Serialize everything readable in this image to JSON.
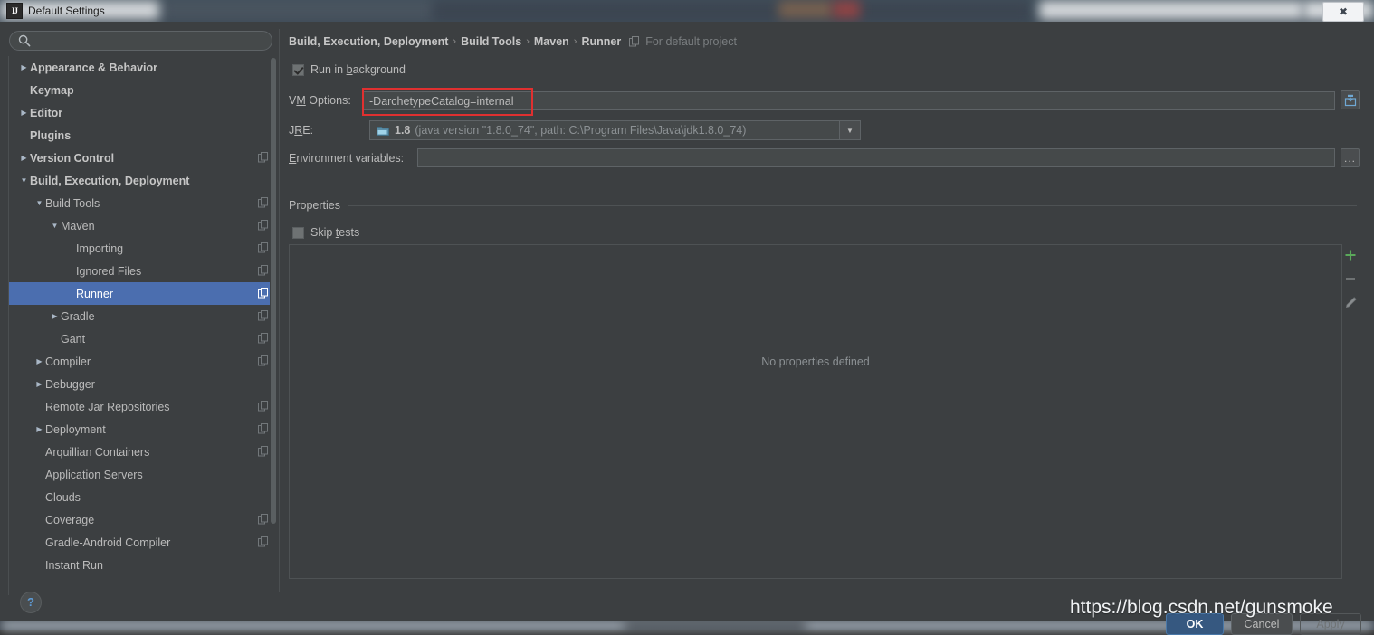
{
  "window": {
    "title": "Default Settings",
    "app_icon": "intellij-idea-icon",
    "close_label": "✖"
  },
  "search": {
    "value": "",
    "placeholder": "",
    "icon": "search-icon"
  },
  "sidebar": {
    "items": [
      {
        "label": "Appearance & Behavior",
        "level": 0,
        "arrow": "▶",
        "bold": true,
        "selected": false,
        "copy": false
      },
      {
        "label": "Keymap",
        "level": 0,
        "arrow": "",
        "bold": true,
        "selected": false,
        "copy": false
      },
      {
        "label": "Editor",
        "level": 0,
        "arrow": "▶",
        "bold": true,
        "selected": false,
        "copy": false
      },
      {
        "label": "Plugins",
        "level": 0,
        "arrow": "",
        "bold": true,
        "selected": false,
        "copy": false
      },
      {
        "label": "Version Control",
        "level": 0,
        "arrow": "▶",
        "bold": true,
        "selected": false,
        "copy": true
      },
      {
        "label": "Build, Execution, Deployment",
        "level": 0,
        "arrow": "▼",
        "bold": true,
        "selected": false,
        "copy": false
      },
      {
        "label": "Build Tools",
        "level": 1,
        "arrow": "▼",
        "bold": false,
        "selected": false,
        "copy": true
      },
      {
        "label": "Maven",
        "level": 2,
        "arrow": "▼",
        "bold": false,
        "selected": false,
        "copy": true
      },
      {
        "label": "Importing",
        "level": 3,
        "arrow": "",
        "bold": false,
        "selected": false,
        "copy": true
      },
      {
        "label": "Ignored Files",
        "level": 3,
        "arrow": "",
        "bold": false,
        "selected": false,
        "copy": true
      },
      {
        "label": "Runner",
        "level": 3,
        "arrow": "",
        "bold": false,
        "selected": true,
        "copy": true
      },
      {
        "label": "Gradle",
        "level": 2,
        "arrow": "▶",
        "bold": false,
        "selected": false,
        "copy": true
      },
      {
        "label": "Gant",
        "level": 2,
        "arrow": "",
        "bold": false,
        "selected": false,
        "copy": true
      },
      {
        "label": "Compiler",
        "level": 1,
        "arrow": "▶",
        "bold": false,
        "selected": false,
        "copy": true
      },
      {
        "label": "Debugger",
        "level": 1,
        "arrow": "▶",
        "bold": false,
        "selected": false,
        "copy": false
      },
      {
        "label": "Remote Jar Repositories",
        "level": 1,
        "arrow": "",
        "bold": false,
        "selected": false,
        "copy": true
      },
      {
        "label": "Deployment",
        "level": 1,
        "arrow": "▶",
        "bold": false,
        "selected": false,
        "copy": true
      },
      {
        "label": "Arquillian Containers",
        "level": 1,
        "arrow": "",
        "bold": false,
        "selected": false,
        "copy": true
      },
      {
        "label": "Application Servers",
        "level": 1,
        "arrow": "",
        "bold": false,
        "selected": false,
        "copy": false
      },
      {
        "label": "Clouds",
        "level": 1,
        "arrow": "",
        "bold": false,
        "selected": false,
        "copy": false
      },
      {
        "label": "Coverage",
        "level": 1,
        "arrow": "",
        "bold": false,
        "selected": false,
        "copy": true
      },
      {
        "label": "Gradle-Android Compiler",
        "level": 1,
        "arrow": "",
        "bold": false,
        "selected": false,
        "copy": true
      },
      {
        "label": "Instant Run",
        "level": 1,
        "arrow": "",
        "bold": false,
        "selected": false,
        "copy": false
      }
    ]
  },
  "breadcrumb": {
    "crumbs": [
      "Build, Execution, Deployment",
      "Build Tools",
      "Maven",
      "Runner"
    ],
    "separator": "›",
    "project_scope": "For default project",
    "project_icon": "copy-icon"
  },
  "main": {
    "run_in_background": {
      "label_pre": "Run in ",
      "label_mnemonic": "b",
      "label_post": "ackground",
      "checked": true
    },
    "vm_options": {
      "label_pre": "V",
      "label_mnemonic": "M",
      "label_post": " Options:",
      "value": "-DarchetypeCatalog=internal",
      "expand_icon": "expand-insert-icon"
    },
    "jre": {
      "label_pre": "J",
      "label_mnemonic": "R",
      "label_post": "E:",
      "version": "1.8",
      "detail": "(java version \"1.8.0_74\", path: C:\\Program Files\\Java\\jdk1.8.0_74)",
      "icon": "folder-icon",
      "dropdown_icon": "chevron-down-icon"
    },
    "environment_variables": {
      "label_pre": "",
      "label_mnemonic": "E",
      "label_post": "nvironment variables:",
      "value": "",
      "browse_label": "..."
    },
    "properties_section": {
      "title": "Properties"
    },
    "skip_tests": {
      "label_pre": "Skip ",
      "label_mnemonic": "t",
      "label_post": "ests",
      "checked": false
    },
    "properties_table": {
      "empty_message": "No properties defined",
      "toolbar": [
        {
          "name": "add-property-button",
          "icon": "plus-icon",
          "color": "#5aa85a"
        },
        {
          "name": "remove-property-button",
          "icon": "minus-icon",
          "color": "#6e7273"
        },
        {
          "name": "edit-property-button",
          "icon": "pencil-icon",
          "color": "#8a8e90"
        }
      ]
    }
  },
  "footer": {
    "help_label": "?",
    "ok_label": "OK",
    "cancel_label": "Cancel",
    "apply_label": "Apply"
  },
  "watermark": {
    "text": "https://blog.csdn.net/gunsmoke"
  },
  "colors": {
    "accent_selection": "#4b6eaf",
    "ok_button": "#365880",
    "highlight_box": "#e03030",
    "panel_bg": "#3c3f41",
    "add_icon": "#5aa85a"
  }
}
